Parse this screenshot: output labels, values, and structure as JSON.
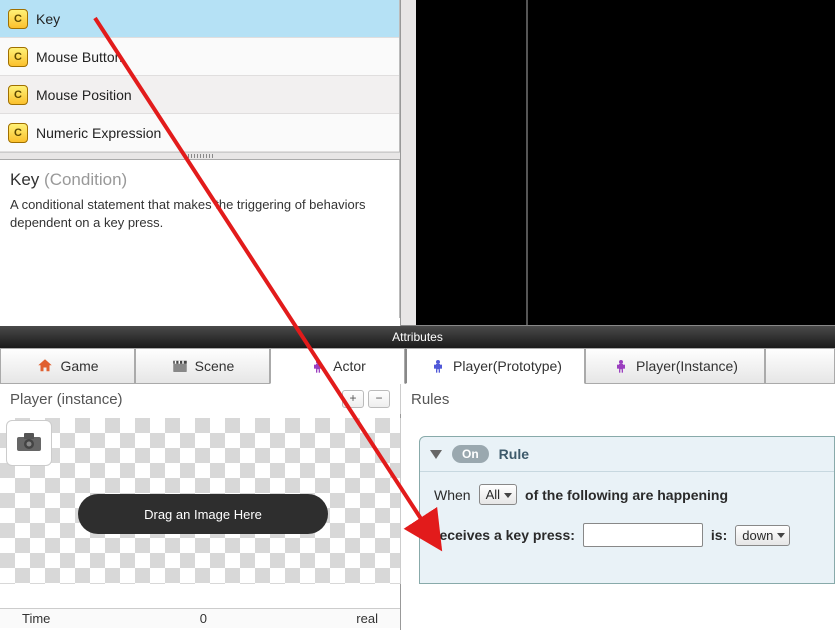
{
  "conditions": {
    "items": [
      {
        "label": "Key"
      },
      {
        "label": "Mouse Button"
      },
      {
        "label": "Mouse Position"
      },
      {
        "label": "Numeric Expression"
      }
    ]
  },
  "description": {
    "title_main": "Key",
    "title_sub": "(Condition)",
    "text": "A conditional statement that makes the triggering of behaviors dependent on a key press."
  },
  "attributesBar": "Attributes",
  "tabs": {
    "game": "Game",
    "scene": "Scene",
    "actor": "Actor",
    "prototype": "Player(Prototype)",
    "instance": "Player(Instance)"
  },
  "instance": {
    "title": "Player (instance)",
    "plus": "+",
    "minus": "−",
    "dragText": "Drag an Image Here"
  },
  "rules": {
    "header": "Rules",
    "panelTitle": "Rule",
    "onLabel": "On",
    "whenLabel": "When",
    "allSelect": "All",
    "whenTail": "of the following are happening",
    "cond_label": "receives a key press:",
    "is_label": "is:",
    "downSelect": "down"
  },
  "timeline": {
    "time": "Time",
    "zero": "0",
    "real": "real"
  },
  "icons": {
    "cond": "C"
  }
}
